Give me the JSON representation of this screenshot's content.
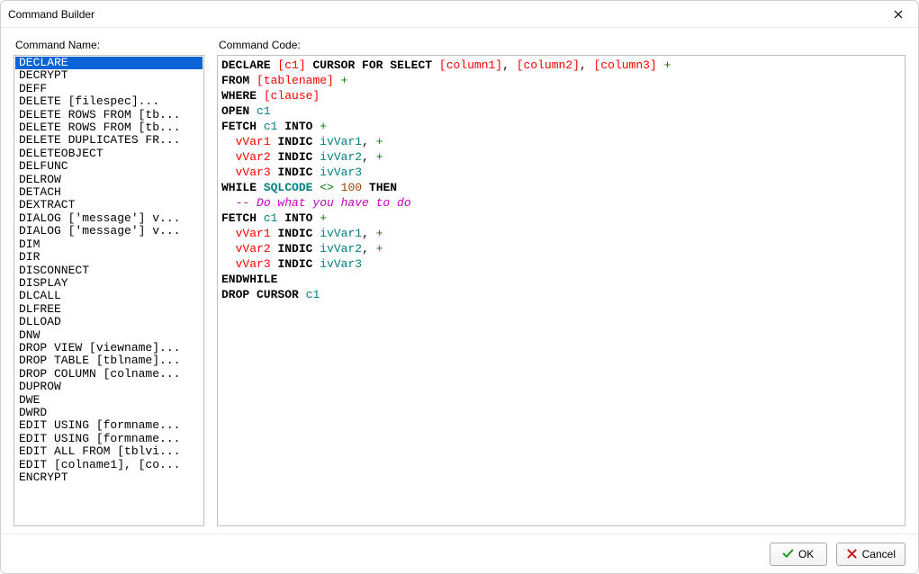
{
  "window": {
    "title": "Command Builder",
    "close_tooltip": "Close"
  },
  "labels": {
    "command_name": "Command Name:",
    "command_code": "Command Code:"
  },
  "command_list": {
    "selected_index": 0,
    "items": [
      "DECLARE",
      "DECRYPT",
      "DEFF",
      "DELETE [filespec]...",
      "DELETE ROWS FROM [tb...",
      "DELETE ROWS FROM [tb...",
      "DELETE DUPLICATES FR...",
      "DELETEOBJECT",
      "DELFUNC",
      "DELROW",
      "DETACH",
      "DEXTRACT",
      "DIALOG ['message'] v...",
      "DIALOG ['message'] v...",
      "DIM",
      "DIR",
      "DISCONNECT",
      "DISPLAY",
      "DLCALL",
      "DLFREE",
      "DLLOAD",
      "DNW",
      "DROP VIEW [viewname]...",
      "DROP TABLE [tblname]...",
      "DROP COLUMN [colname...",
      "DUPROW",
      "DWE",
      "DWRD",
      "EDIT USING [formname...",
      "EDIT USING [formname...",
      "EDIT ALL FROM [tblvi...",
      "EDIT [colname1], [co...",
      "ENCRYPT"
    ]
  },
  "code": {
    "lines": [
      [
        {
          "t": "key",
          "v": "DECLARE"
        },
        {
          "t": "txt",
          "v": " "
        },
        {
          "t": "ph",
          "v": "[c1]"
        },
        {
          "t": "txt",
          "v": " "
        },
        {
          "t": "key",
          "v": "CURSOR FOR SELECT"
        },
        {
          "t": "txt",
          "v": " "
        },
        {
          "t": "ph",
          "v": "[column1]"
        },
        {
          "t": "txt",
          "v": ", "
        },
        {
          "t": "ph",
          "v": "[column2]"
        },
        {
          "t": "txt",
          "v": ", "
        },
        {
          "t": "ph",
          "v": "[column3]"
        },
        {
          "t": "txt",
          "v": " "
        },
        {
          "t": "cont",
          "v": "+"
        }
      ],
      [
        {
          "t": "key",
          "v": "FROM"
        },
        {
          "t": "txt",
          "v": " "
        },
        {
          "t": "ph",
          "v": "[tablename]"
        },
        {
          "t": "txt",
          "v": " "
        },
        {
          "t": "cont",
          "v": "+"
        }
      ],
      [
        {
          "t": "key",
          "v": "WHERE"
        },
        {
          "t": "txt",
          "v": " "
        },
        {
          "t": "ph",
          "v": "[clause]"
        }
      ],
      [
        {
          "t": "key",
          "v": "OPEN"
        },
        {
          "t": "txt",
          "v": " "
        },
        {
          "t": "id",
          "v": "c1"
        }
      ],
      [
        {
          "t": "key",
          "v": "FETCH"
        },
        {
          "t": "txt",
          "v": " "
        },
        {
          "t": "id",
          "v": "c1"
        },
        {
          "t": "txt",
          "v": " "
        },
        {
          "t": "key",
          "v": "INTO"
        },
        {
          "t": "txt",
          "v": " "
        },
        {
          "t": "cont",
          "v": "+"
        }
      ],
      [
        {
          "t": "txt",
          "v": "  "
        },
        {
          "t": "ph",
          "v": "vVar1"
        },
        {
          "t": "txt",
          "v": " "
        },
        {
          "t": "key",
          "v": "INDIC"
        },
        {
          "t": "txt",
          "v": " "
        },
        {
          "t": "id",
          "v": "ivVar1"
        },
        {
          "t": "txt",
          "v": ", "
        },
        {
          "t": "cont",
          "v": "+"
        }
      ],
      [
        {
          "t": "txt",
          "v": "  "
        },
        {
          "t": "ph",
          "v": "vVar2"
        },
        {
          "t": "txt",
          "v": " "
        },
        {
          "t": "key",
          "v": "INDIC"
        },
        {
          "t": "txt",
          "v": " "
        },
        {
          "t": "id",
          "v": "ivVar2"
        },
        {
          "t": "txt",
          "v": ", "
        },
        {
          "t": "cont",
          "v": "+"
        }
      ],
      [
        {
          "t": "txt",
          "v": "  "
        },
        {
          "t": "ph",
          "v": "vVar3"
        },
        {
          "t": "txt",
          "v": " "
        },
        {
          "t": "key",
          "v": "INDIC"
        },
        {
          "t": "txt",
          "v": " "
        },
        {
          "t": "id",
          "v": "ivVar3"
        }
      ],
      [
        {
          "t": "key",
          "v": "WHILE"
        },
        {
          "t": "txt",
          "v": " "
        },
        {
          "t": "idk",
          "v": "SQLCODE"
        },
        {
          "t": "txt",
          "v": " "
        },
        {
          "t": "cont",
          "v": "<>"
        },
        {
          "t": "txt",
          "v": " "
        },
        {
          "t": "num",
          "v": "100"
        },
        {
          "t": "txt",
          "v": " "
        },
        {
          "t": "key",
          "v": "THEN"
        }
      ],
      [
        {
          "t": "txt",
          "v": "  "
        },
        {
          "t": "com",
          "v": "-- Do what you have to do"
        }
      ],
      [
        {
          "t": "key",
          "v": "FETCH"
        },
        {
          "t": "txt",
          "v": " "
        },
        {
          "t": "id",
          "v": "c1"
        },
        {
          "t": "txt",
          "v": " "
        },
        {
          "t": "key",
          "v": "INTO"
        },
        {
          "t": "txt",
          "v": " "
        },
        {
          "t": "cont",
          "v": "+"
        }
      ],
      [
        {
          "t": "txt",
          "v": "  "
        },
        {
          "t": "ph",
          "v": "vVar1"
        },
        {
          "t": "txt",
          "v": " "
        },
        {
          "t": "key",
          "v": "INDIC"
        },
        {
          "t": "txt",
          "v": " "
        },
        {
          "t": "id",
          "v": "ivVar1"
        },
        {
          "t": "txt",
          "v": ", "
        },
        {
          "t": "cont",
          "v": "+"
        }
      ],
      [
        {
          "t": "txt",
          "v": "  "
        },
        {
          "t": "ph",
          "v": "vVar2"
        },
        {
          "t": "txt",
          "v": " "
        },
        {
          "t": "key",
          "v": "INDIC"
        },
        {
          "t": "txt",
          "v": " "
        },
        {
          "t": "id",
          "v": "ivVar2"
        },
        {
          "t": "txt",
          "v": ", "
        },
        {
          "t": "cont",
          "v": "+"
        }
      ],
      [
        {
          "t": "txt",
          "v": "  "
        },
        {
          "t": "ph",
          "v": "vVar3"
        },
        {
          "t": "txt",
          "v": " "
        },
        {
          "t": "key",
          "v": "INDIC"
        },
        {
          "t": "txt",
          "v": " "
        },
        {
          "t": "id",
          "v": "ivVar3"
        }
      ],
      [
        {
          "t": "key",
          "v": "ENDWHILE"
        }
      ],
      [
        {
          "t": "key",
          "v": "DROP CURSOR"
        },
        {
          "t": "txt",
          "v": " "
        },
        {
          "t": "id",
          "v": "c1"
        }
      ]
    ]
  },
  "buttons": {
    "ok": "OK",
    "cancel": "Cancel"
  }
}
